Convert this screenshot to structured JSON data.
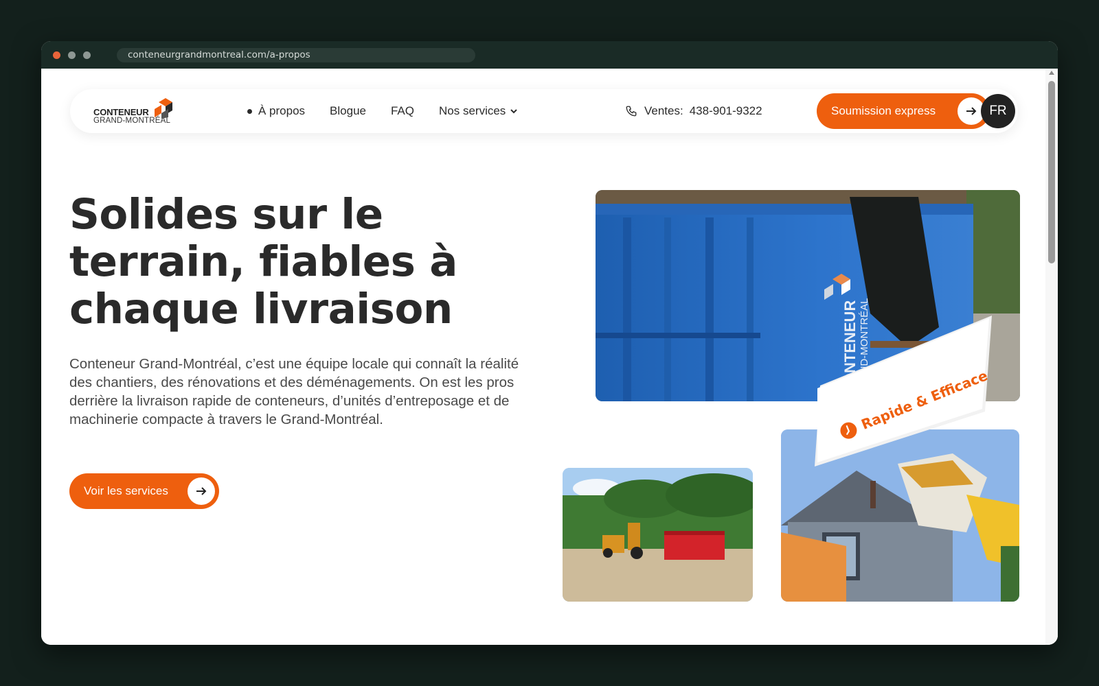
{
  "browser": {
    "url": "conteneurgrandmontreal.com/a-propos"
  },
  "logo": {
    "line1": "CONTENEUR",
    "line2": "GRAND-MONTRÉAL"
  },
  "nav": {
    "items": [
      {
        "label": "À propos",
        "active": true
      },
      {
        "label": "Blogue"
      },
      {
        "label": "FAQ"
      },
      {
        "label": "Nos services",
        "dropdown": true
      }
    ],
    "phone_label": "Ventes:",
    "phone_number": "438-901-9322",
    "cta_label": "Soumission express",
    "lang": "FR"
  },
  "hero": {
    "title": "Solides sur le terrain, fiables à chaque livraison",
    "text": "Conteneur Grand-Montréal, c’est une équipe locale qui connaît la réalité des chantiers, des rénovations et des déménagements. On est les pros derrière la livraison rapide de conteneurs, d’unités d’entreposage et de machinerie compacte à travers le Grand-Montréal.",
    "button_label": "Voir les services",
    "ribbon_label": "Rapide & Efficace"
  },
  "photos": {
    "dumpster_logo_line1": "CONTENEUR",
    "dumpster_logo_line2": "GRAND-MONTRÉAL"
  },
  "colors": {
    "accent": "#ee5f0e",
    "dark": "#2a2a2a",
    "frame": "#13201c"
  },
  "icons": [
    "phone-icon",
    "chevron-down-icon",
    "arrow-right-icon",
    "clock-icon"
  ]
}
